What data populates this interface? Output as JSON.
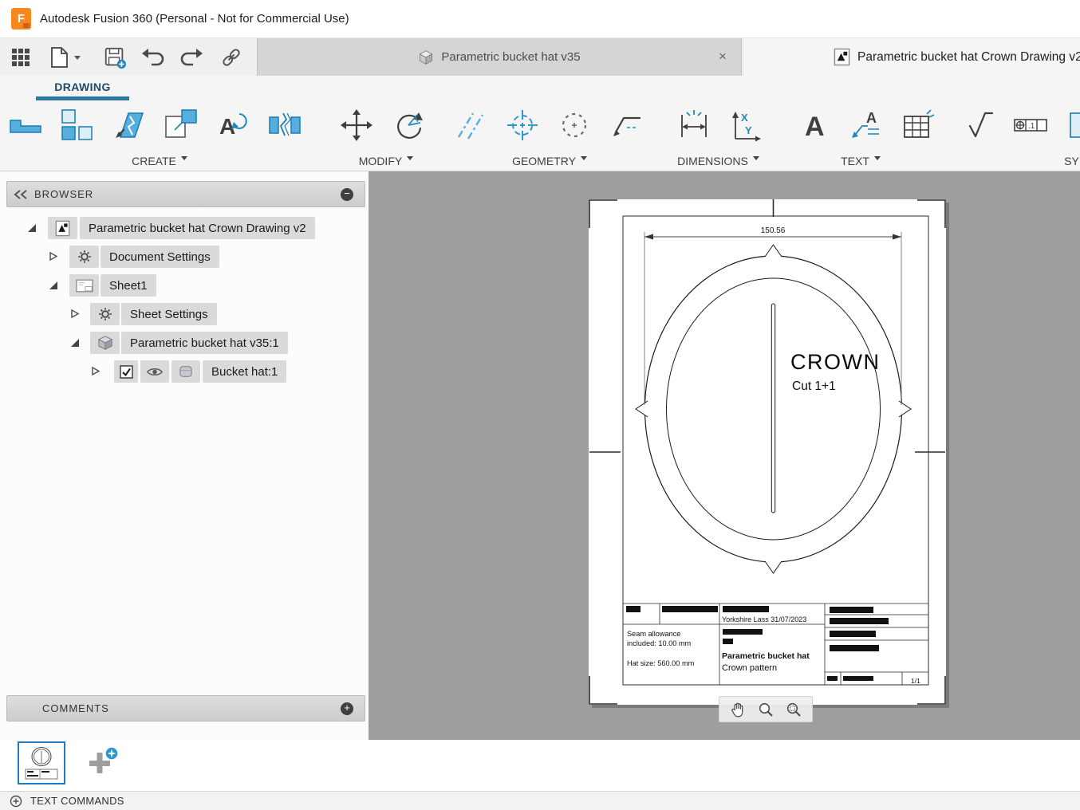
{
  "titlebar": {
    "app_title": "Autodesk Fusion 360 (Personal - Not for Commercial Use)"
  },
  "glyphs": {
    "close": "×",
    "minus": "−",
    "plus": "+"
  },
  "document_tabs": {
    "inactive": {
      "label": "Parametric bucket hat v35"
    },
    "active": {
      "label": "Parametric bucket hat Crown Drawing v2"
    }
  },
  "ribbon": {
    "workspace_tab": "DRAWING",
    "groups": {
      "create": "CREATE",
      "modify": "MODIFY",
      "geometry": "GEOMETRY",
      "dimensions": "DIMENSIONS",
      "text": "TEXT",
      "symbols": "SYMBOLS"
    }
  },
  "browser": {
    "header": "BROWSER",
    "rows": [
      {
        "label": "Parametric bucket hat Crown Drawing v2"
      },
      {
        "label": "Document Settings"
      },
      {
        "label": "Sheet1"
      },
      {
        "label": "Sheet Settings"
      },
      {
        "label": "Parametric bucket hat v35:1"
      },
      {
        "label": "Bucket hat:1"
      }
    ]
  },
  "comments": {
    "header": "COMMENTS"
  },
  "drawing": {
    "dimension_width": "150.56",
    "crown_title": "CROWN",
    "cut_note": "Cut 1+1",
    "title_block": {
      "author_date": "Yorkshire Lass  31/07/2023",
      "note_line1": "Seam allowance",
      "note_line2": "included: 10.00 mm",
      "note_line3": "Hat size: 560.00 mm",
      "part_name": "Parametric bucket hat",
      "drawing_name": "Crown pattern",
      "sheet_number": "1/1"
    }
  },
  "status_bar": {
    "text_commands_label": "TEXT COMMANDS"
  }
}
